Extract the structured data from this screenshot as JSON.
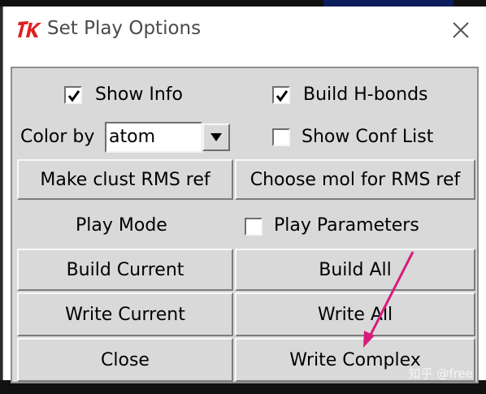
{
  "window": {
    "title": "Set Play Options",
    "logo": "tk-feather-logo",
    "close_icon": "close-icon"
  },
  "options": {
    "show_info": {
      "label": "Show Info",
      "checked": true
    },
    "build_hbonds": {
      "label": "Build  H-bonds",
      "checked": true
    },
    "color_by": {
      "label": "Color by",
      "value": "atom"
    },
    "show_conf_list": {
      "label": "Show Conf List",
      "checked": false
    },
    "play_mode": {
      "label": "Play Mode"
    },
    "play_parameters": {
      "label": "Play Parameters",
      "checked": false
    }
  },
  "buttons": {
    "make_clust_rms_ref": "Make clust RMS ref",
    "choose_mol_for_rms_ref": "Choose mol for RMS ref",
    "build_current": "Build Current",
    "build_all": "Build All",
    "write_current": "Write Current",
    "write_all": "Write All",
    "close": "Close",
    "write_complex": "Write Complex"
  },
  "annotation": {
    "type": "arrow",
    "color": "#d81b7a",
    "points_to": "write_complex"
  },
  "watermark": "知乎 @free",
  "colors": {
    "panel_bg": "#d9d9d9",
    "title_text": "#4a4a4a",
    "logo_red": "#e02020",
    "annotation_magenta": "#d81b7a"
  }
}
